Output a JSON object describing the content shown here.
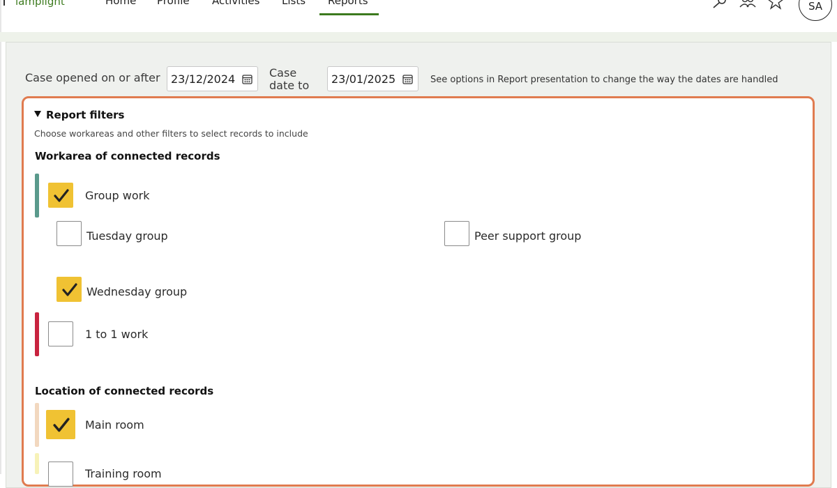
{
  "nav": {
    "brand": "lamplight",
    "items": [
      "Home",
      "Profile",
      "Activities",
      "Lists",
      "Reports"
    ],
    "active": "Reports",
    "icons": [
      "search-icon",
      "users-icon",
      "star-icon"
    ],
    "avatar_initials": "SA",
    "accent_color": "#3c7a1e"
  },
  "dates": {
    "from_label": "Case opened on or after",
    "from_value": "23/12/2024",
    "to_label_line1": "Case",
    "to_label_line2": "date to",
    "to_value": "23/01/2025",
    "hint": "See options in Report presentation to change the way the dates are handled"
  },
  "filters": {
    "title": "Report filters",
    "subtitle": "Choose workareas and other filters to select records to include",
    "border_color": "#e07b4f",
    "workarea": {
      "title": "Workarea of connected records",
      "group_work": {
        "label": "Group work",
        "checked": true,
        "bar_color": "#5a9a8c"
      },
      "tuesday": {
        "label": "Tuesday group",
        "checked": false
      },
      "peer_support": {
        "label": "Peer support group",
        "checked": false
      },
      "wednesday": {
        "label": "Wednesday group",
        "checked": true
      },
      "one_to_one": {
        "label": "1 to 1 work",
        "checked": false,
        "bar_color": "#c8233f"
      }
    },
    "location": {
      "title": "Location of connected records",
      "main_room": {
        "label": "Main room",
        "checked": true,
        "bar_color": "#f2d8bf"
      },
      "training_room": {
        "label": "Training room",
        "checked": false,
        "bar_color": "#f7f2b8"
      }
    },
    "checked_color": "#f0c233"
  }
}
